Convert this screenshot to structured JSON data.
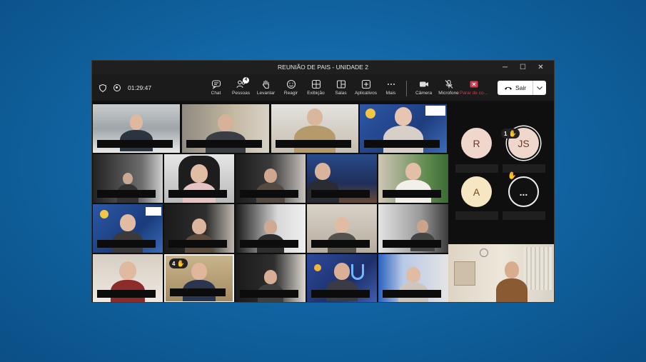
{
  "window": {
    "title": "REUNIÃO DE PAIS - UNIDADE 2",
    "controls": {
      "minimize": "─",
      "maximize": "☐",
      "close": "✕"
    }
  },
  "toolbar": {
    "timer": "01:29:47",
    "buttons": [
      {
        "label": "Chat",
        "icon": "chat-icon"
      },
      {
        "label": "Pessoas",
        "icon": "people-icon",
        "badge": "4"
      },
      {
        "label": "Levantar",
        "icon": "raise-hand-icon"
      },
      {
        "label": "Reagir",
        "icon": "react-icon"
      },
      {
        "label": "Exibição",
        "icon": "view-icon"
      },
      {
        "label": "Salas",
        "icon": "rooms-icon"
      },
      {
        "label": "Aplicativos",
        "icon": "apps-icon"
      },
      {
        "label": "Mais",
        "icon": "more-icon"
      }
    ],
    "devices": [
      {
        "label": "Câmera",
        "icon": "camera-icon"
      },
      {
        "label": "Microfone",
        "icon": "mic-off-icon"
      },
      {
        "label": "Parar de co...",
        "icon": "stop-share-icon"
      }
    ],
    "leave_label": "Sair"
  },
  "participants": {
    "raised_hand_video": "4",
    "avatars": [
      {
        "initials": "R",
        "color": "#f0d7cc"
      },
      {
        "initials": "JS",
        "color": "#f0d7cc",
        "hand": "1"
      },
      {
        "initials": "A",
        "color": "#f7e6c2"
      },
      {
        "initials": "...",
        "color": "#111111"
      }
    ]
  },
  "colors": {
    "accent_red": "#d23c4b",
    "hand_yellow": "#f2b92a"
  }
}
